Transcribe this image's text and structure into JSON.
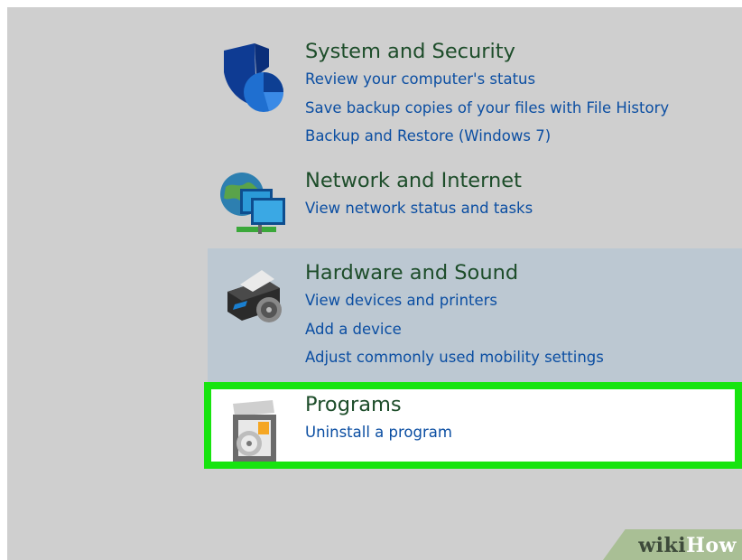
{
  "categories": {
    "system": {
      "title": "System and Security",
      "icon": "shield-icon",
      "links": [
        "Review your computer's status",
        "Save backup copies of your files with File History",
        "Backup and Restore (Windows 7)"
      ]
    },
    "network": {
      "title": "Network and Internet",
      "icon": "network-icon",
      "links": [
        "View network status and tasks"
      ]
    },
    "hardware": {
      "title": "Hardware and Sound",
      "icon": "printer-icon",
      "state": "hovered",
      "links": [
        "View devices and printers",
        "Add a device",
        "Adjust commonly used mobility settings"
      ]
    },
    "programs": {
      "title": "Programs",
      "icon": "programs-icon",
      "state": "highlighted",
      "links": [
        "Uninstall a program"
      ]
    }
  },
  "watermark": {
    "brand": "wikiHow",
    "part1": "wiki",
    "part2": "How"
  },
  "colors": {
    "background": "#cfcfcf",
    "title": "#1d4d2a",
    "link": "#0b4ea2",
    "hover_row": "#bcc8d2",
    "highlight_border": "#17e40f"
  }
}
